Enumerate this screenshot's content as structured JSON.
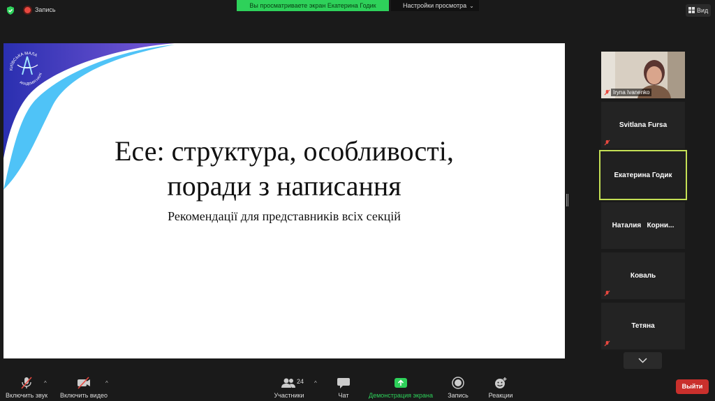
{
  "topbar": {
    "recording_label": "Запись",
    "share_banner": "Вы просматриваете экран Екатерина Годик",
    "view_settings": "Настройки просмотра",
    "view_button": "Вид"
  },
  "slide": {
    "title_line1": "Есе: структура, особливості,",
    "title_line2": "поради з написання",
    "subtitle": "Рекомендації для представників всіх секцій",
    "logo_text": "ЛИВСЬКА МАЛА АКАДЕМІЯ НАУК"
  },
  "participants": [
    {
      "name": "Iryna Ivanenko",
      "type": "video",
      "muted": true
    },
    {
      "name": "Svitlana Fursa",
      "type": "name",
      "muted": true
    },
    {
      "name": "Екатерина Годик",
      "type": "name",
      "muted": false,
      "active": true
    },
    {
      "name": "Наталия   Корни...",
      "type": "name",
      "muted": false
    },
    {
      "name": "Коваль",
      "type": "name",
      "muted": true
    },
    {
      "name": "Тетяна",
      "type": "name",
      "muted": true
    }
  ],
  "toolbar": {
    "audio": "Включить звук",
    "video": "Включить видео",
    "participants": "Участники",
    "participants_count": "24",
    "chat": "Чат",
    "share": "Демонстрация экрана",
    "record": "Запись",
    "reactions": "Реакции",
    "leave": "Выйти"
  },
  "colors": {
    "share_green": "#2ed15a",
    "active_border": "#c5e055",
    "leave_red": "#c9302c",
    "slide_wave_blue": "#4fc3f7",
    "slide_wave_violet": "#5b3fc9"
  }
}
